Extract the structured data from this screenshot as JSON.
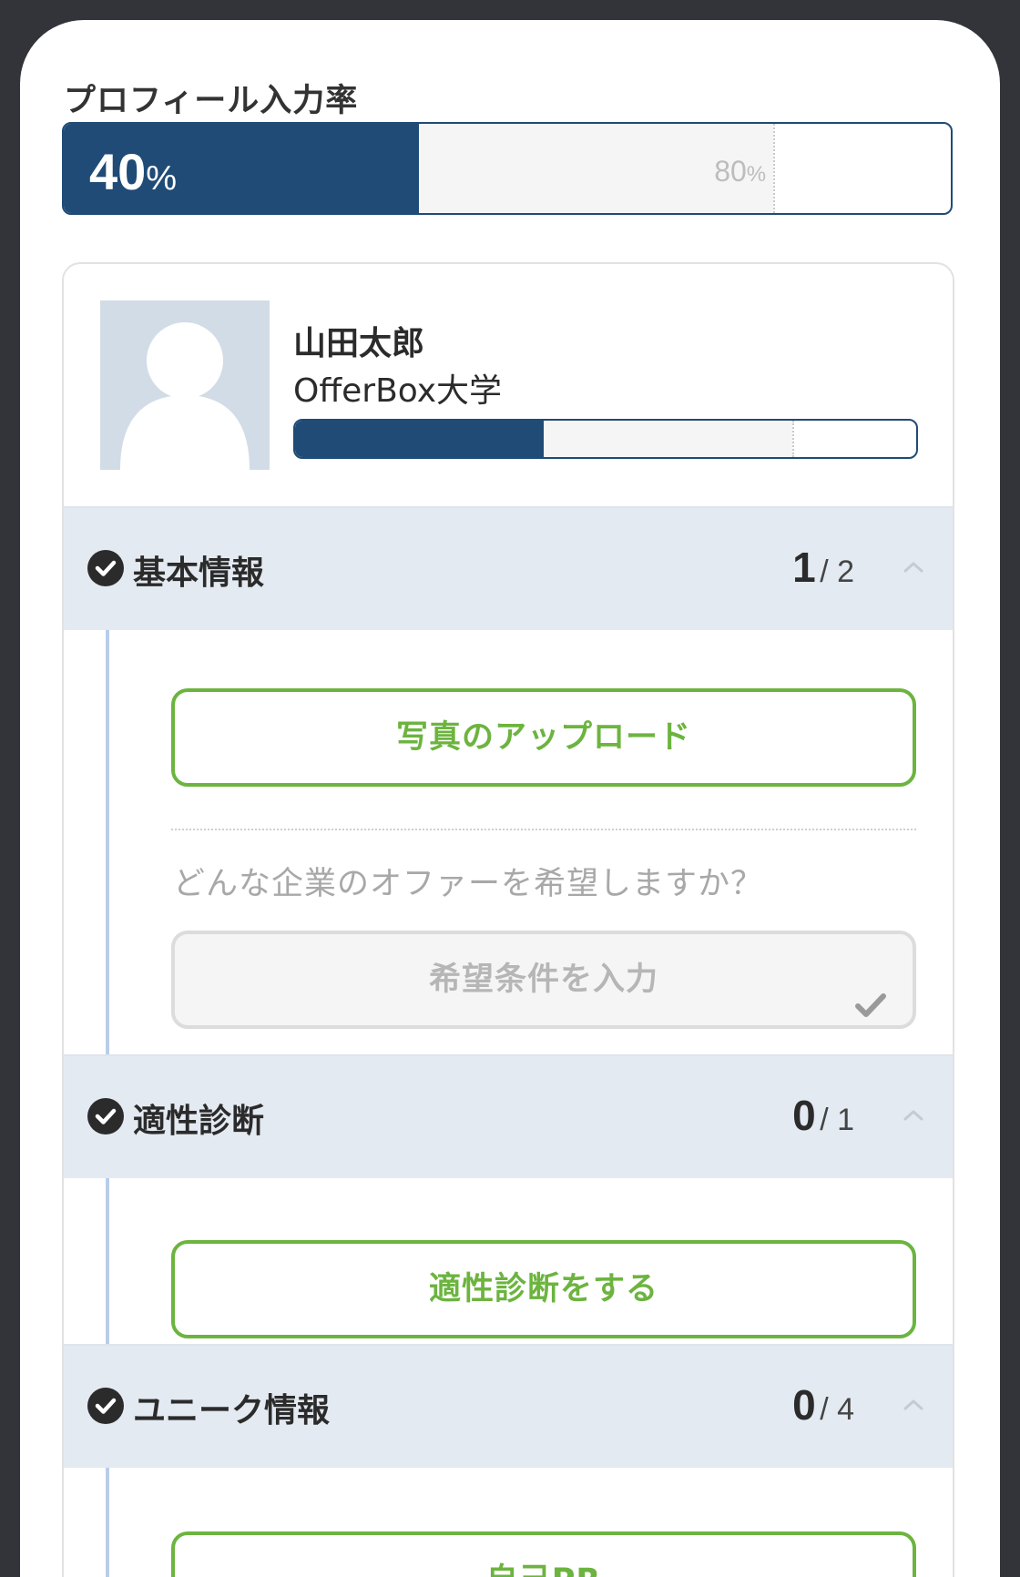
{
  "page": {
    "title": "プロフィール入力率"
  },
  "progress": {
    "value": 40,
    "unit": "%",
    "marker_value": 80,
    "marker_unit": "%"
  },
  "user": {
    "name": "山田太郎",
    "school": "OfferBox大学",
    "progress": 40,
    "marker_value": 80
  },
  "sections": [
    {
      "title": "基本情報",
      "done": "1",
      "total": "/ 2",
      "actions": {
        "upload_button": "写真のアップロード",
        "prompt": "どんな企業のオファーを希望しますか？",
        "preference_button": "希望条件を入力"
      }
    },
    {
      "title": "適性診断",
      "done": "0",
      "total": "/ 1",
      "actions": {
        "diagnosis_button": "適性診断をする"
      }
    },
    {
      "title": "ユニーク情報",
      "done": "0",
      "total": "/ 4",
      "actions": {
        "self_pr_button": "自己PR"
      }
    }
  ],
  "colors": {
    "primary": "#1f4b76",
    "accent_green": "#6cb43f",
    "section_bg": "#e4eaf2",
    "timeline": "#b9cdea"
  },
  "icons": {
    "section_status": "check-circle-icon",
    "section_toggle": "chevron-up-icon",
    "avatar": "avatar-placeholder-icon",
    "preference_done": "checkmark-icon"
  }
}
